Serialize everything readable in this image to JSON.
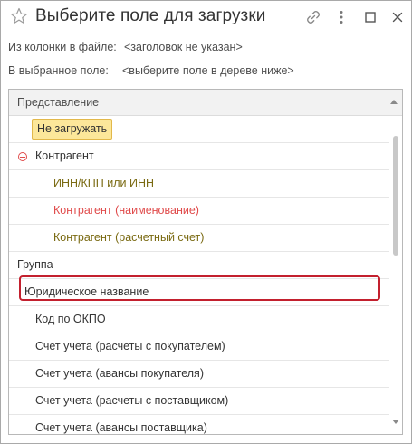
{
  "window": {
    "title": "Выберите поле для загрузки"
  },
  "info": {
    "file_column_label": "Из колонки в файле:",
    "file_column_value": "<заголовок не указан>",
    "target_field_label": "В выбранное поле:",
    "target_field_value": "<выберите поле в дереве ниже>"
  },
  "tree": {
    "header": "Представление",
    "items": [
      {
        "label": "Не загружать",
        "level": 0,
        "state": "selected"
      },
      {
        "label": "Контрагент",
        "level": 0,
        "state": "group-expanded",
        "color": "#e04b4b"
      },
      {
        "label": "ИНН/КПП или ИНН",
        "level": 1,
        "color": "#7a6a12"
      },
      {
        "label": "Контрагент (наименование)",
        "level": 1,
        "color": "#e04b4b"
      },
      {
        "label": "Контрагент (расчетный счет)",
        "level": 1,
        "color": "#7a6a12"
      },
      {
        "label": "Группа",
        "level": 0
      },
      {
        "label": "Юридическое название",
        "level": 0,
        "state": "highlighted"
      },
      {
        "label": "Код по ОКПО",
        "level": 0
      },
      {
        "label": "Счет учета (расчеты с покупателем)",
        "level": 0
      },
      {
        "label": "Счет учета (авансы покупателя)",
        "level": 0
      },
      {
        "label": "Счет учета (расчеты с поставщиком)",
        "level": 0
      },
      {
        "label": "Счет учета (авансы поставщика)",
        "level": 0
      }
    ]
  },
  "icons": {
    "favorite": "star-icon",
    "link": "link-icon",
    "more": "more-icon",
    "maximize": "maximize-icon",
    "close": "close-icon"
  },
  "colors": {
    "highlight_border": "#c3202e",
    "selected_fill": "#fce79a",
    "required_field": "#e04b4b",
    "optional_field": "#7a6a12"
  }
}
